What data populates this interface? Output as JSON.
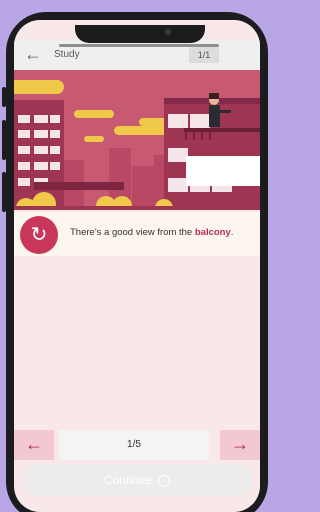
{
  "header": {
    "back_icon": "arrow-left-icon",
    "title": "Study",
    "counter": "1/1",
    "progress": 1.0
  },
  "lesson": {
    "sentence_before": "There's a good view from the ",
    "keyword": "balcony",
    "sentence_after": ".",
    "audio_icon": "replay-icon"
  },
  "pager": {
    "prev_icon": "arrow-left-icon",
    "page": "1/5",
    "next_icon": "arrow-right-icon"
  },
  "footer": {
    "continue_label": "Continue",
    "continue_icon": "circle-arrow-right-icon"
  },
  "colors": {
    "accent": "#c8365a",
    "background": "#b9a6e6",
    "scene_sky": "#c75a72",
    "scene_building": "#9e3552",
    "scene_yellow": "#f0c84a"
  }
}
